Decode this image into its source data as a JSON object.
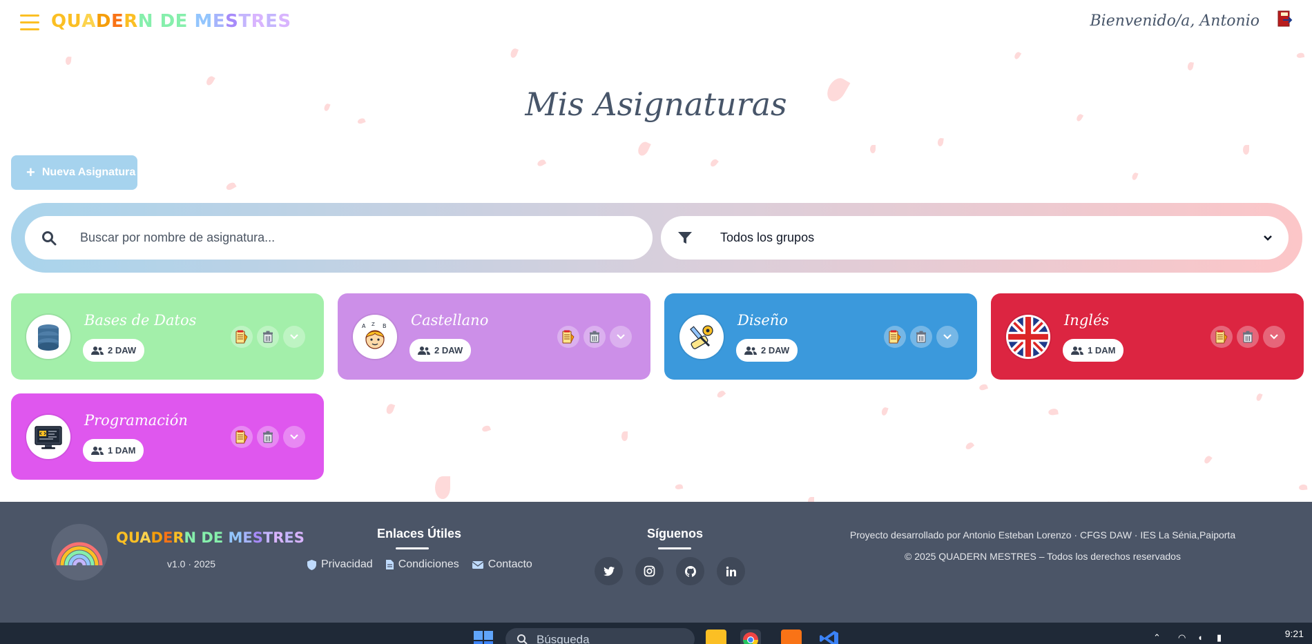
{
  "header": {
    "logo_letters": [
      "Q",
      "U",
      "A",
      "D",
      "E",
      "R",
      "N",
      " ",
      "D",
      "E",
      " ",
      "M",
      "E",
      "S",
      "T",
      "R",
      "E",
      "S"
    ],
    "logo_colors": [
      "#fbbf24",
      "#fbbf24",
      "#fcd34d",
      "#f59e0b",
      "#f97316",
      "#fbbf24",
      "#86efac",
      " ",
      "#86efac",
      "#86efac",
      " ",
      "#93c5fd",
      "#a5b4fc",
      "#a78bfa",
      "#c4b5fd",
      "#d8b4fe",
      "#c4b5fd",
      "#d8b4fe"
    ],
    "welcome": "Bienvenido/a, Antonio"
  },
  "page": {
    "title": "Mis Asignaturas",
    "new_button": "Nueva Asignatura"
  },
  "filters": {
    "search_placeholder": "Buscar por nombre de asignatura...",
    "group_selected": "Todos los grupos"
  },
  "subjects": [
    {
      "name": "Bases de Datos",
      "group": "2 DAW",
      "color": "#a3efaa",
      "icon": "database-icon"
    },
    {
      "name": "Castellano",
      "group": "2 DAW",
      "color": "#cc8fe8",
      "icon": "abc-child-icon"
    },
    {
      "name": "Diseño",
      "group": "2 DAW",
      "color": "#3b99dc",
      "icon": "design-tools-icon"
    },
    {
      "name": "Inglés",
      "group": "1 DAM",
      "color": "#dc2541",
      "icon": "uk-flag-icon"
    },
    {
      "name": "Programación",
      "group": "1 DAM",
      "color": "#df57ee",
      "icon": "code-monitor-icon"
    }
  ],
  "footer": {
    "brand": "QUADERN DE MESTRES",
    "version": "v1.0 · 2025",
    "links_title": "Enlaces Útiles",
    "links": [
      "Privacidad",
      "Condiciones",
      "Contacto"
    ],
    "social_title": "Síguenos",
    "credit": "Proyecto desarrollado por Antonio Esteban Lorenzo · CFGS DAW · IES La Sénia,Paiporta",
    "copyright": "© 2025 QUADERN MESTRES – Todos los derechos reservados"
  },
  "taskbar": {
    "search": "Búsqueda",
    "time": "9:21"
  }
}
